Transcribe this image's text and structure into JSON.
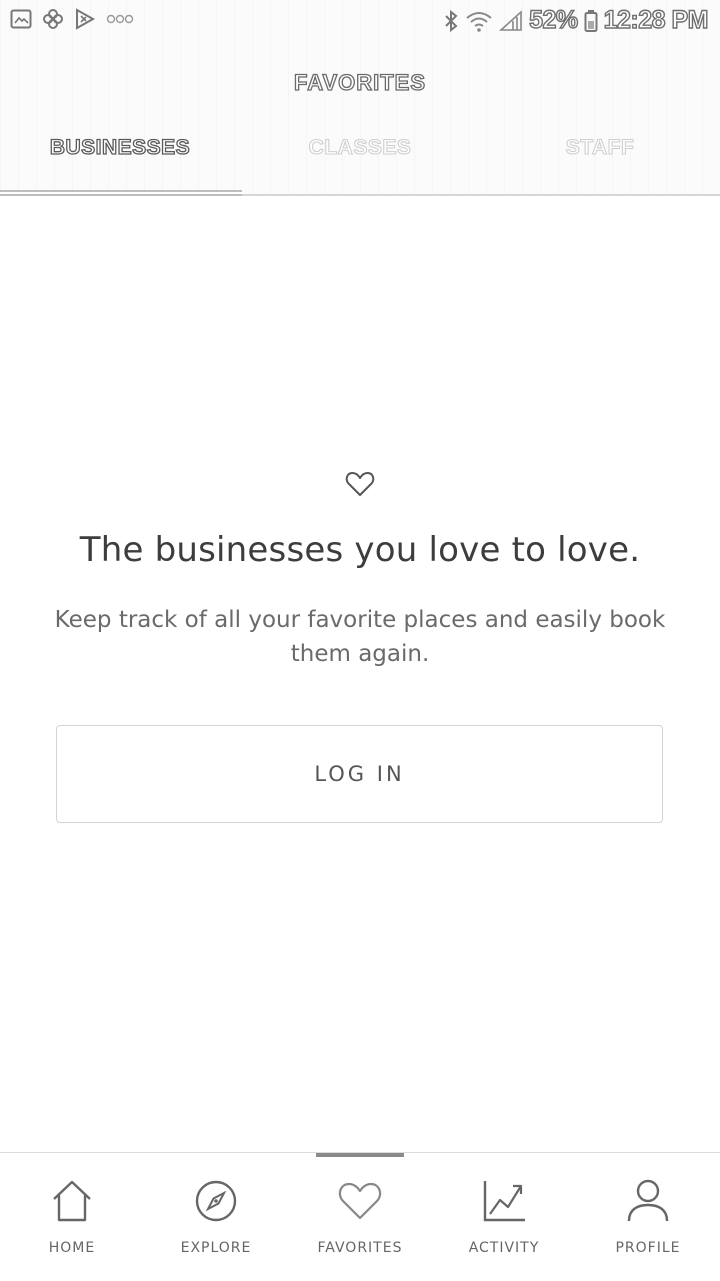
{
  "status_bar": {
    "battery": "52%",
    "time": "12:28 PM",
    "left_icons": [
      "gallery-icon",
      "pinwheel-icon",
      "play-store-icon",
      "more-dots-icon"
    ],
    "right_icons": [
      "bluetooth-icon",
      "wifi-icon",
      "signal-icon",
      "battery-icon"
    ]
  },
  "header": {
    "title": "FAVORITES"
  },
  "tabs": [
    {
      "label": "BUSINESSES",
      "active": true
    },
    {
      "label": "CLASSES",
      "active": false
    },
    {
      "label": "STAFF",
      "active": false
    }
  ],
  "empty_state": {
    "icon": "heart-outline-icon",
    "headline": "The businesses you love to love.",
    "description": "Keep track of all your favorite places and easily book them again.",
    "button": "LOG IN"
  },
  "bottom_nav": [
    {
      "label": "HOME",
      "icon": "home-icon"
    },
    {
      "label": "EXPLORE",
      "icon": "compass-icon"
    },
    {
      "label": "FAVORITES",
      "icon": "heart-icon",
      "active": true
    },
    {
      "label": "ACTIVITY",
      "icon": "activity-chart-icon"
    },
    {
      "label": "PROFILE",
      "icon": "person-icon"
    }
  ],
  "colors": {
    "text": "#3d3d3d",
    "muted": "#6a6a6a",
    "border": "#d4d4d4",
    "indicator": "#8a8a8a"
  }
}
